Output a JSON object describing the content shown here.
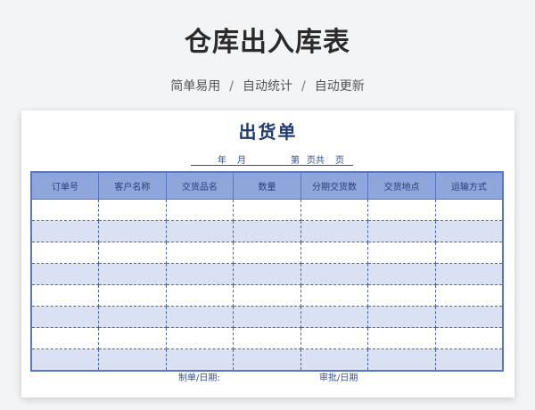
{
  "header": {
    "title": "仓库出入库表",
    "features": [
      "简单易用",
      "自动统计",
      "自动更新"
    ],
    "separator": "/"
  },
  "sheet": {
    "title": "出货单",
    "date_line": {
      "year": "年",
      "month": "月",
      "page_prefix": "第",
      "page_mid": "页共",
      "page_suffix": "页"
    },
    "columns": [
      "订单号",
      "客户名称",
      "交货品名",
      "数量",
      "分期交货数",
      "交货地点",
      "运输方式"
    ],
    "rows": [
      [
        "",
        "",
        "",
        "",
        "",
        "",
        ""
      ],
      [
        "",
        "",
        "",
        "",
        "",
        "",
        ""
      ],
      [
        "",
        "",
        "",
        "",
        "",
        "",
        ""
      ],
      [
        "",
        "",
        "",
        "",
        "",
        "",
        ""
      ],
      [
        "",
        "",
        "",
        "",
        "",
        "",
        ""
      ],
      [
        "",
        "",
        "",
        "",
        "",
        "",
        ""
      ],
      [
        "",
        "",
        "",
        "",
        "",
        "",
        ""
      ],
      [
        "",
        "",
        "",
        "",
        "",
        "",
        ""
      ]
    ],
    "footer": {
      "maker": "制单/日期:",
      "reviewer": "审批/日期"
    }
  },
  "colors": {
    "header_fill": "#8ea6dc",
    "band_fill": "#d9e1f2",
    "border": "#5a76c1",
    "title": "#1f3b70"
  }
}
